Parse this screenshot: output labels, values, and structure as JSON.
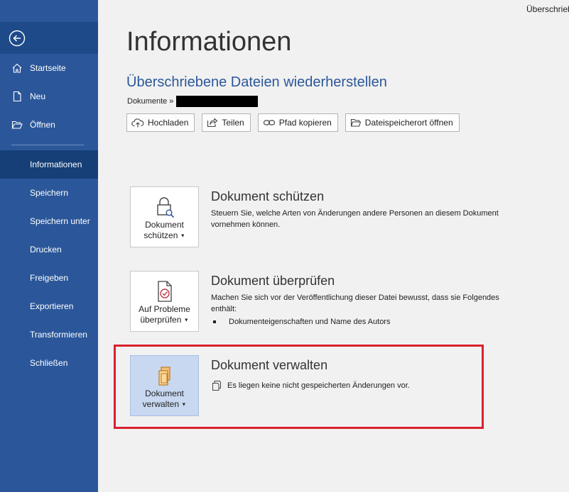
{
  "window": {
    "doc_title": "Überschriebene"
  },
  "sidebar": {
    "items": [
      {
        "label": "Startseite",
        "icon": "home-icon"
      },
      {
        "label": "Neu",
        "icon": "new-document-icon"
      },
      {
        "label": "Öffnen",
        "icon": "folder-open-icon"
      },
      {
        "label": "Informationen"
      },
      {
        "label": "Speichern"
      },
      {
        "label": "Speichern unter"
      },
      {
        "label": "Drucken"
      },
      {
        "label": "Freigeben"
      },
      {
        "label": "Exportieren"
      },
      {
        "label": "Transformieren"
      },
      {
        "label": "Schließen"
      }
    ],
    "active_index": 3
  },
  "main": {
    "title": "Informationen",
    "file_title": "Überschriebene Dateien wiederherstellen",
    "breadcrumb": "Dokumente »",
    "actions": [
      {
        "label": "Hochladen",
        "icon": "cloud-upload-icon"
      },
      {
        "label": "Teilen",
        "icon": "share-icon"
      },
      {
        "label": "Pfad kopieren",
        "icon": "link-icon"
      },
      {
        "label": "Dateispeicherort öffnen",
        "icon": "folder-icon"
      }
    ],
    "sections": [
      {
        "button_line1": "Dokument",
        "button_line2": "schützen",
        "title": "Dokument schützen",
        "desc_line1": "Steuern Sie, welche Arten von Änderungen andere Personen an diesem Dokument",
        "desc_line2": "vornehmen können."
      },
      {
        "button_line1": "Auf Probleme",
        "button_line2": "überprüfen",
        "title": "Dokument überprüfen",
        "desc_line1": "Machen Sie sich vor der Veröffentlichung dieser Datei bewusst, dass sie Folgendes",
        "desc_line2": "enthält:",
        "bullet": "Dokumenteigenschaften und Name des Autors"
      },
      {
        "button_line1": "Dokument",
        "button_line2": "verwalten",
        "title": "Dokument verwalten",
        "status": "Es liegen keine nicht gespeicherten Änderungen vor."
      }
    ]
  },
  "colors": {
    "sidebar": "#2b579a",
    "accent": "#2b579a",
    "highlight": "#d9212e"
  }
}
